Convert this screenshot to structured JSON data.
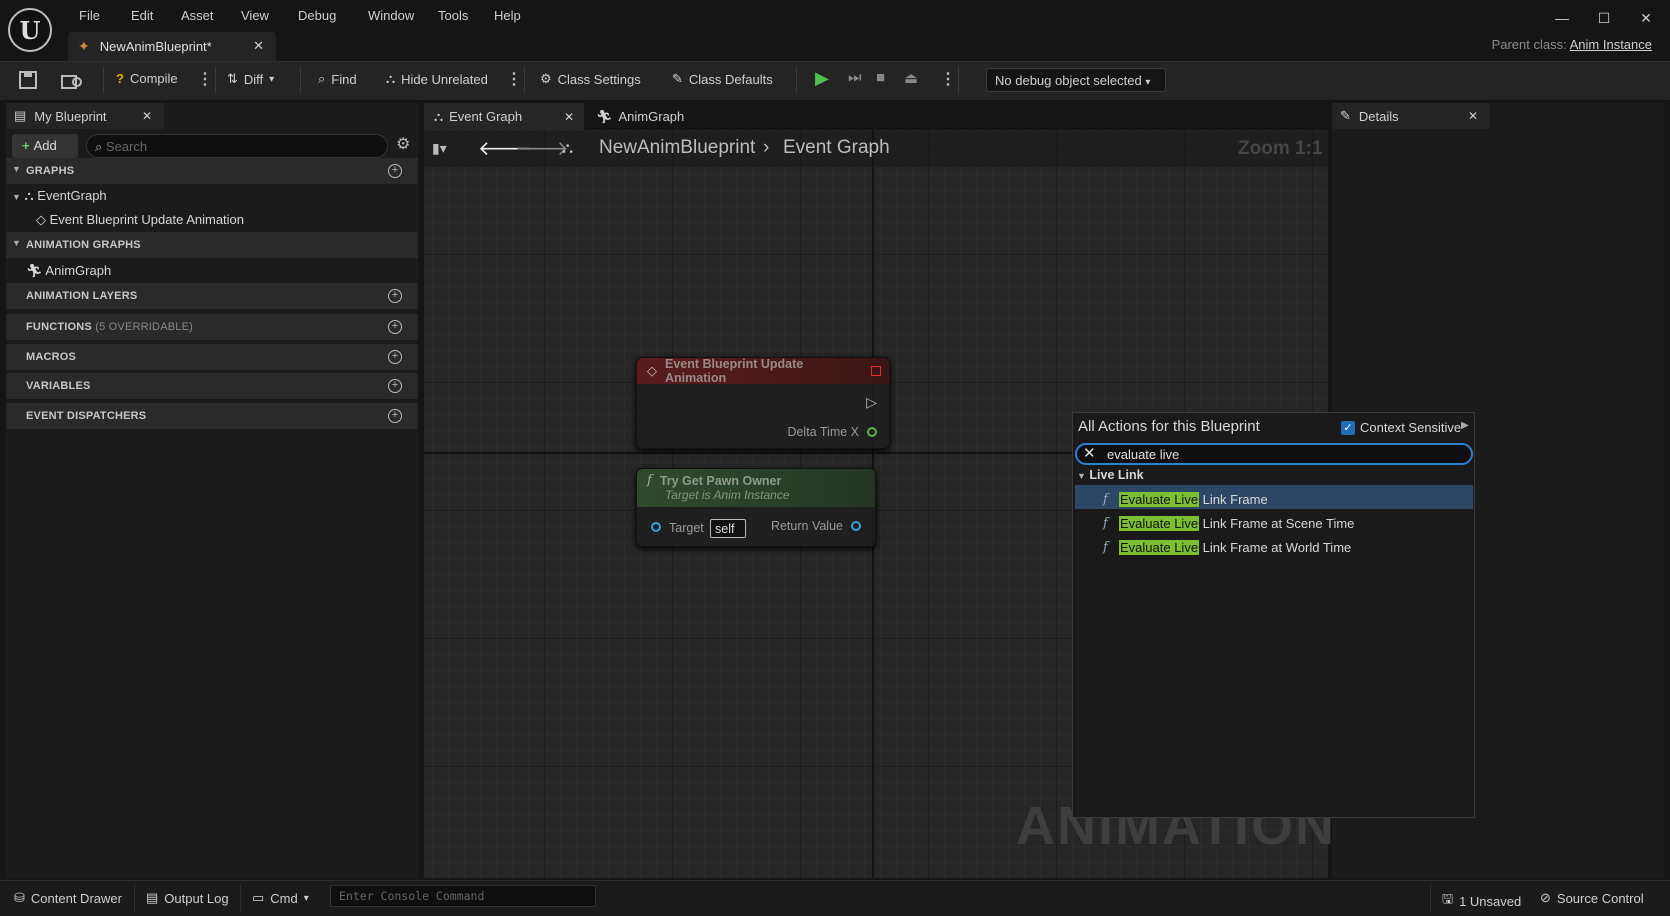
{
  "menu": [
    "File",
    "Edit",
    "Asset",
    "View",
    "Debug",
    "Window",
    "Tools",
    "Help"
  ],
  "document_tab": "NewAnimBlueprint*",
  "parent_class_label": "Parent class:",
  "parent_class_value": "Anim Instance",
  "toolbar": {
    "compile": "Compile",
    "diff": "Diff",
    "find": "Find",
    "hide_unrelated": "Hide Unrelated",
    "class_settings": "Class Settings",
    "class_defaults": "Class Defaults",
    "debug_object": "No debug object selected"
  },
  "my_blueprint": {
    "tab": "My Blueprint",
    "add": "Add",
    "search_placeholder": "Search",
    "sections": {
      "graphs": "GRAPHS",
      "animation_graphs": "ANIMATION GRAPHS",
      "animation_layers": "ANIMATION LAYERS",
      "functions": "FUNCTIONS",
      "functions_note": "(5 OVERRIDABLE)",
      "macros": "MACROS",
      "variables": "VARIABLES",
      "event_dispatchers": "EVENT DISPATCHERS"
    },
    "event_graph": "EventGraph",
    "event_update": "Event Blueprint Update Animation",
    "anim_graph": "AnimGraph"
  },
  "graph_tabs": [
    "Event Graph",
    "AnimGraph"
  ],
  "breadcrumb": {
    "root": "NewAnimBlueprint",
    "current": "Event Graph"
  },
  "zoom": "Zoom 1:1",
  "watermark": "ANIMATION",
  "nodes": {
    "event": {
      "title": "Event Blueprint Update Animation",
      "pin": "Delta Time X"
    },
    "pawn": {
      "title": "Try Get Pawn Owner",
      "subtitle": "Target is Anim Instance",
      "target": "Target",
      "target_value": "self",
      "return": "Return Value"
    }
  },
  "details_tab": "Details",
  "action_menu": {
    "title": "All Actions for this Blueprint",
    "context_sensitive": "Context Sensitive",
    "search_value": "evaluate live",
    "category": "Live Link",
    "results": [
      {
        "match": "Evaluate Live",
        "rest": " Link Frame"
      },
      {
        "match": "Evaluate Live",
        "rest": " Link Frame at Scene Time"
      },
      {
        "match": "Evaluate Live",
        "rest": " Link Frame at World Time"
      }
    ]
  },
  "statusbar": {
    "content_drawer": "Content Drawer",
    "output_log": "Output Log",
    "cmd": "Cmd",
    "console_placeholder": "Enter Console Command",
    "unsaved": "1 Unsaved",
    "source_control": "Source Control"
  }
}
